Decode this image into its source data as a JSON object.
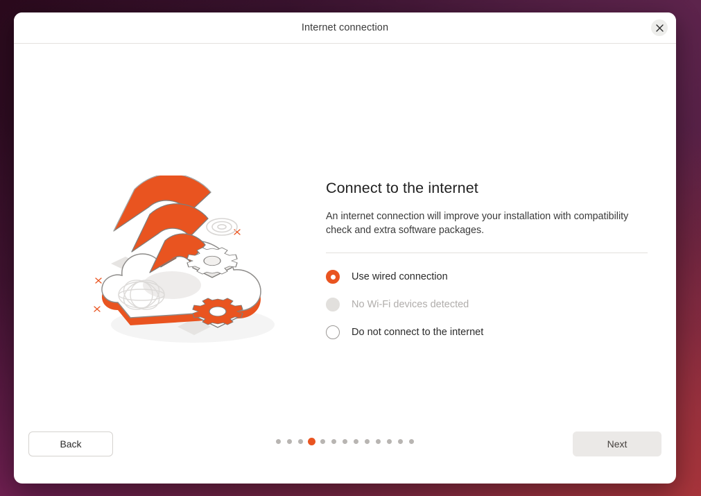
{
  "window": {
    "title": "Internet connection",
    "close_icon": "close-icon"
  },
  "page": {
    "title": "Connect to the internet",
    "description": "An internet connection will improve your installation with compatibility check and extra software packages."
  },
  "options": [
    {
      "label": "Use wired connection",
      "state": "selected",
      "disabled": false
    },
    {
      "label": "No Wi-Fi devices detected",
      "state": "muted",
      "disabled": true
    },
    {
      "label": "Do not connect to the internet",
      "state": "off",
      "disabled": false
    }
  ],
  "footer": {
    "back_label": "Back",
    "next_label": "Next",
    "pagination": {
      "total": 13,
      "current": 4
    }
  },
  "illustration": {
    "name": "wifi-cloud-illustration",
    "alt": "Isometric cloud with Wi-Fi signal arcs and gears"
  },
  "colors": {
    "accent": "#e95420",
    "text_primary": "#1f1f1f",
    "text_secondary": "#3a3a3a",
    "text_disabled": "#b0adab",
    "divider": "#e2e0dd",
    "dot_inactive": "#b8b5b2",
    "button_next_bg": "#ebe9e7",
    "desktop_bg": "#2b0a1d"
  }
}
